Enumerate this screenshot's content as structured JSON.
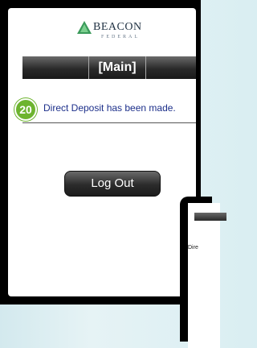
{
  "brand": {
    "name": "BEACON",
    "sub": "FEDERAL"
  },
  "screen": {
    "title": "[Main]"
  },
  "step_badge": "20",
  "message": "Direct Deposit has been made.",
  "logout_label": "Log Out",
  "second_screen": {
    "message_fragment": "Dire"
  },
  "colors": {
    "accent_green": "#6db42f",
    "message_blue": "#1c2f8a",
    "button_dark": "#2b2b2b"
  }
}
